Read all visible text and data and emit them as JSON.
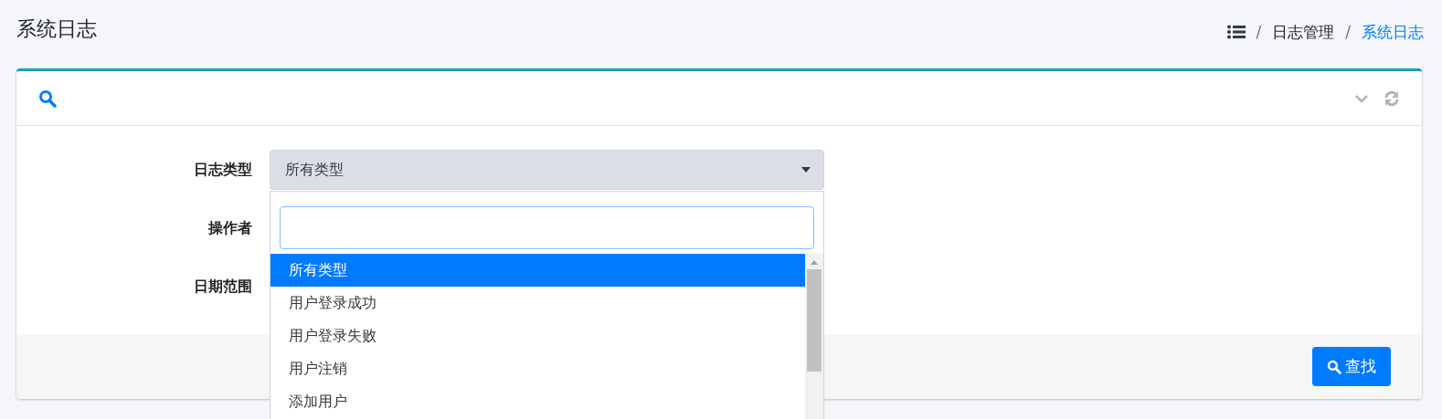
{
  "page_title": "系统日志",
  "breadcrumb": [
    {
      "separator": "/",
      "label": "日志管理",
      "active": false
    },
    {
      "separator": "/",
      "label": "系统日志",
      "active": true
    }
  ],
  "form": {
    "fields": [
      {
        "kind": "select",
        "label": "日志类型",
        "value": "所有类型"
      },
      {
        "kind": "text",
        "label": "操作者"
      },
      {
        "kind": "text",
        "label": "日期范围"
      }
    ]
  },
  "dropdown": {
    "options": [
      {
        "label": "所有类型",
        "selected": true
      },
      {
        "label": "用户登录成功",
        "selected": false
      },
      {
        "label": "用户登录失败",
        "selected": false
      },
      {
        "label": "用户注销",
        "selected": false
      },
      {
        "label": "添加用户",
        "selected": false
      }
    ]
  },
  "search_button": "查找"
}
